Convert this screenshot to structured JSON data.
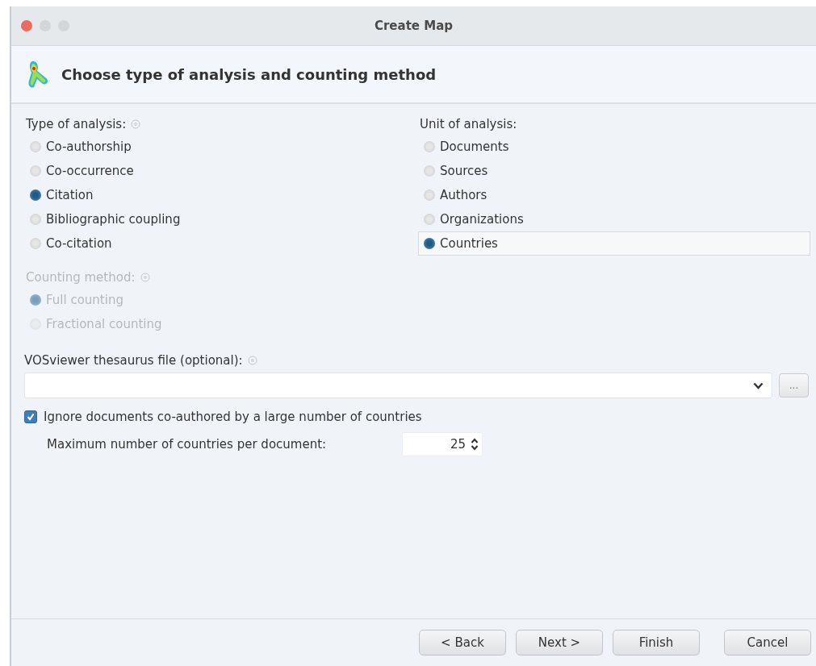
{
  "window": {
    "title": "Create Map"
  },
  "header": {
    "title": "Choose type of analysis and counting method"
  },
  "type_of_analysis": {
    "label": "Type of analysis:",
    "disabled": false,
    "options": [
      {
        "label": "Co-authorship",
        "selected": false
      },
      {
        "label": "Co-occurrence",
        "selected": false
      },
      {
        "label": "Citation",
        "selected": true
      },
      {
        "label": "Bibliographic coupling",
        "selected": false
      },
      {
        "label": "Co-citation",
        "selected": false
      }
    ]
  },
  "unit_of_analysis": {
    "label": "Unit of analysis:",
    "disabled": false,
    "options": [
      {
        "label": "Documents",
        "selected": false
      },
      {
        "label": "Sources",
        "selected": false
      },
      {
        "label": "Authors",
        "selected": false
      },
      {
        "label": "Organizations",
        "selected": false
      },
      {
        "label": "Countries",
        "selected": true
      }
    ]
  },
  "counting_method": {
    "label": "Counting method:",
    "disabled": true,
    "options": [
      {
        "label": "Full counting",
        "selected": true
      },
      {
        "label": "Fractional counting",
        "selected": false
      }
    ]
  },
  "thesaurus": {
    "label": "VOSviewer thesaurus file (optional):",
    "browse_button": "..."
  },
  "ignore_documents": {
    "label": "Ignore documents co-authored by a large number of countries",
    "checked": true
  },
  "max_countries": {
    "label": "Maximum number of countries per document:",
    "value": "25"
  },
  "buttons": [
    "< Back",
    "Next >",
    "Finish",
    "Cancel"
  ]
}
